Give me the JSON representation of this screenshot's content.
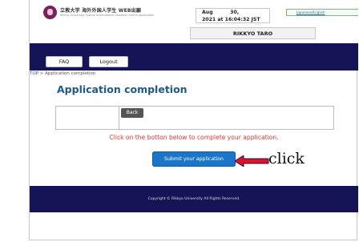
{
  "header": {
    "university_name": "立教大学 海外外国人学生 WEB出願",
    "university_sub": "Rikkyo University Special International Students Online Application",
    "date_line1": "Aug          30,",
    "date_line2": "2021 at 16:04:32 JST",
    "language_link": "Japanese/English",
    "user_name": "RIKKYO TARO"
  },
  "nav": {
    "faq_label": "FAQ",
    "logout_label": "Logout"
  },
  "breadcrumb": {
    "top": "TOP",
    "separator": ">",
    "current": "Application completion"
  },
  "main": {
    "title": "Application completion",
    "back_label": "Back",
    "instruction": "Click on the botton below to complete your application.",
    "submit_label": "Submit your application",
    "annotation": "click"
  },
  "footer": {
    "copyright": "Copyright © Rikkyo University All Rights Reserved."
  },
  "colors": {
    "nav_bg": "#141457",
    "title": "#1d5a8a",
    "instruction": "#e53333",
    "submit_bg": "#1976c9",
    "arrow": "#e0102a"
  }
}
